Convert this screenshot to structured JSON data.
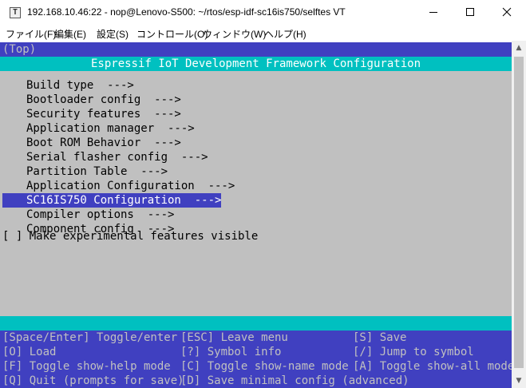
{
  "window": {
    "title": "192.168.10.46:22 - nop@Lenovo-S500: ~/rtos/esp-idf-sc16is750/selftes VT",
    "icon_label": "T",
    "controls": [
      "minimize-icon",
      "maximize-icon",
      "close-icon"
    ]
  },
  "menubar": {
    "items": [
      "ファイル(F)",
      "編集(E)",
      "設定(S)",
      "コントロール(O)",
      "ウィンドウ(W)",
      "ヘルプ(H)"
    ]
  },
  "terminal": {
    "breadcrumb": "(Top)",
    "header": "Espressif IoT Development Framework Configuration",
    "selected_index": 8,
    "menu_items": [
      "Build type  --->",
      "Bootloader config  --->",
      "Security features  --->",
      "Application manager  --->",
      "Boot ROM Behavior  --->",
      "Serial flasher config  --->",
      "Partition Table  --->",
      "Application Configuration  --->",
      "SC16IS750 Configuration  --->",
      "Compiler options  --->",
      "Component config  --->"
    ],
    "checkbox_item": "[ ] Make experimental features visible",
    "keys": [
      [
        "[Space/Enter] Toggle/enter",
        "[ESC] Leave menu",
        "[S] Save"
      ],
      [
        "[O] Load",
        "[?] Symbol info",
        "[/] Jump to symbol"
      ],
      [
        "[F] Toggle show-help mode",
        "[C] Toggle show-name mode",
        "[A] Toggle show-all mode"
      ],
      [
        "[Q] Quit (prompts for save)",
        "[D] Save minimal config (advanced)"
      ]
    ],
    "colors": {
      "blue": "#4040c0",
      "cyan": "#00c0c0",
      "gray": "#c0c0c0",
      "white": "#ffffff",
      "black": "#000000"
    }
  },
  "scrollbar": {
    "up_icon": "▲",
    "down_icon": "▼"
  }
}
